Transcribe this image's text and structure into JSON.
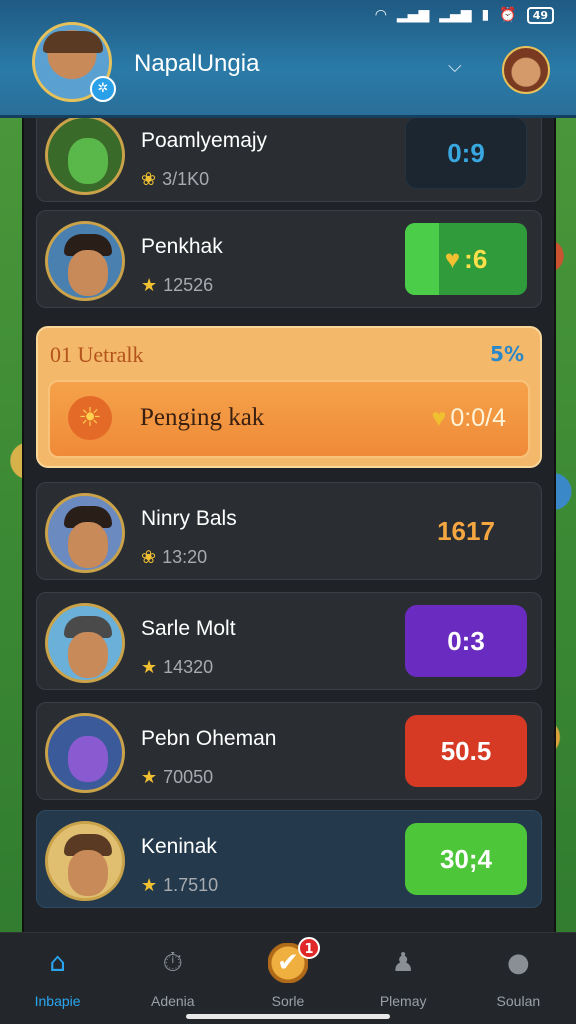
{
  "status_bar": {
    "battery": "49"
  },
  "header": {
    "player_name": "NapalUngia",
    "badge_icon": "sport-icon"
  },
  "rows": [
    {
      "name": "Poamlyemajy",
      "stat": "3/1K0",
      "stat_icon": "laurel-icon",
      "score": "0:9",
      "score_style": "dark",
      "avatar_skin": "#5ab84a"
    },
    {
      "name": "Penkhak",
      "stat": "12526",
      "stat_icon": "star-icon",
      "score": ":6",
      "score_style": "green",
      "avatar_skin": "#c98a5a"
    },
    {
      "name": "Ninry Bals",
      "stat": "13:20",
      "stat_icon": "laurel-icon",
      "score": "1617",
      "score_style": "plain",
      "avatar_skin": "#c98a5a"
    },
    {
      "name": "Sarle Molt",
      "stat": "14320",
      "stat_icon": "star-icon",
      "score": "0:3",
      "score_style": "purple",
      "avatar_skin": "#c98a5a"
    },
    {
      "name": "Pebn Oheman",
      "stat": "70050",
      "stat_icon": "star-icon",
      "score": "50.5",
      "score_style": "red",
      "avatar_skin": "#8a5ad0"
    },
    {
      "name": "Keninak",
      "stat": "1.7510",
      "stat_icon": "star-icon",
      "score": "30;4",
      "score_style": "lime",
      "avatar_skin": "#c98a5a"
    }
  ],
  "highlight": {
    "rank_label": "01 Uetralk",
    "badge": "5%",
    "name": "Penging kak",
    "score": "0:0/4"
  },
  "nav": [
    {
      "label": "Inbapie",
      "icon": "home-icon",
      "active": true
    },
    {
      "label": "Adenia",
      "icon": "timer-icon",
      "active": false
    },
    {
      "label": "Sorle",
      "icon": "check-badge-icon",
      "active": false,
      "notification": "1"
    },
    {
      "label": "Plemay",
      "icon": "character-icon",
      "active": false
    },
    {
      "label": "Soulan",
      "icon": "gamepad-icon",
      "active": false
    }
  ],
  "colors": {
    "header": "#2a7aa8",
    "active_nav": "#2aa6f0",
    "highlight": "#f3b86a"
  }
}
